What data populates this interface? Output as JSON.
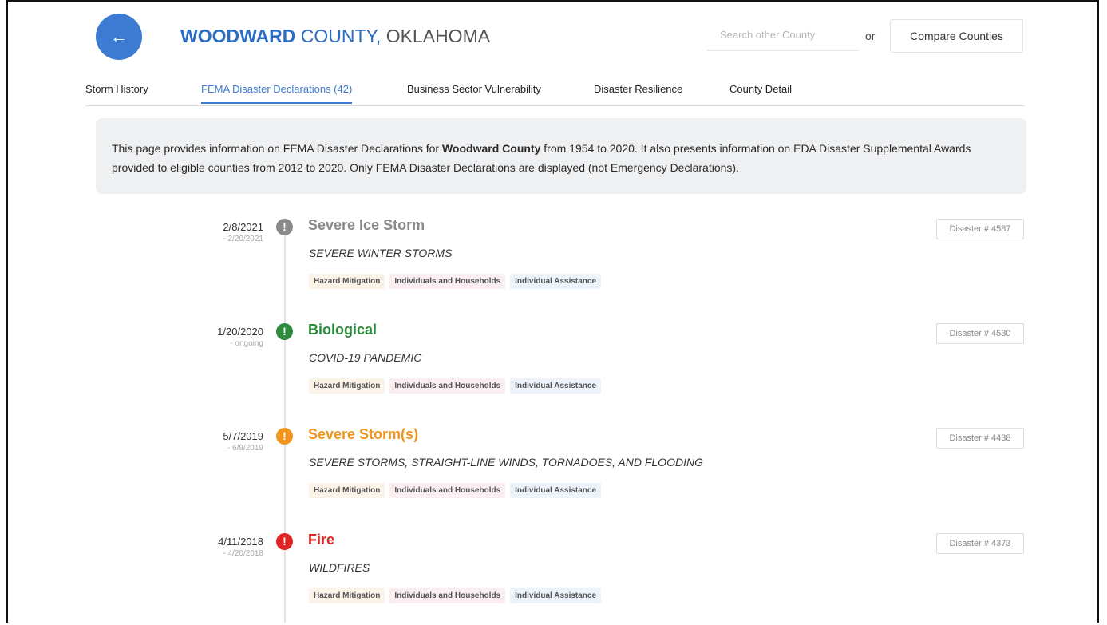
{
  "header": {
    "back_icon": "arrow-left-icon",
    "county": "WOODWARD",
    "county_suffix": " COUNTY",
    "comma": ",",
    "state": " OKLAHOMA",
    "search_placeholder": "Search other County",
    "or_text": "or",
    "compare_label": "Compare Counties"
  },
  "tabs": [
    {
      "label": "Storm History",
      "active": false
    },
    {
      "label": "FEMA Disaster Declarations (42)",
      "active": true
    },
    {
      "label": "Business Sector Vulnerability",
      "active": false
    },
    {
      "label": "Disaster Resilience",
      "active": false
    },
    {
      "label": "County Detail",
      "active": false
    }
  ],
  "info": {
    "part1": "This page provides information on FEMA Disaster Declarations for ",
    "county_bold": "Woodward County",
    "part2": " from 1954 to 2020. It also presents information on EDA Disaster Supplemental Awards provided to eligible counties from 2012 to 2020. Only FEMA Disaster Declarations are displayed (not Emergency Declarations)."
  },
  "events": [
    {
      "start": "2/8/2021",
      "end": "- 2/20/2021",
      "title": "Severe Ice Storm",
      "subtitle": "SEVERE WINTER STORMS",
      "color": "#8a8a8a",
      "disaster": "Disaster # 4587",
      "tags": [
        "Hazard Mitigation",
        "Individuals and Households",
        "Individual Assistance"
      ]
    },
    {
      "start": "1/20/2020",
      "end": "- ongoing",
      "title": "Biological",
      "subtitle": "COVID-19 PANDEMIC",
      "color": "#2e8b3e",
      "disaster": "Disaster # 4530",
      "tags": [
        "Hazard Mitigation",
        "Individuals and Households",
        "Individual Assistance"
      ]
    },
    {
      "start": "5/7/2019",
      "end": "- 6/9/2019",
      "title": "Severe Storm(s)",
      "subtitle": "SEVERE STORMS, STRAIGHT-LINE WINDS, TORNADOES, AND FLOODING",
      "color": "#f0961e",
      "disaster": "Disaster # 4438",
      "tags": [
        "Hazard Mitigation",
        "Individuals and Households",
        "Individual Assistance"
      ]
    },
    {
      "start": "4/11/2018",
      "end": "- 4/20/2018",
      "title": "Fire",
      "subtitle": "WILDFIRES",
      "color": "#e02424",
      "disaster": "Disaster # 4373",
      "tags": [
        "Hazard Mitigation",
        "Individuals and Households",
        "Individual Assistance"
      ]
    }
  ],
  "marker_glyph": "!"
}
